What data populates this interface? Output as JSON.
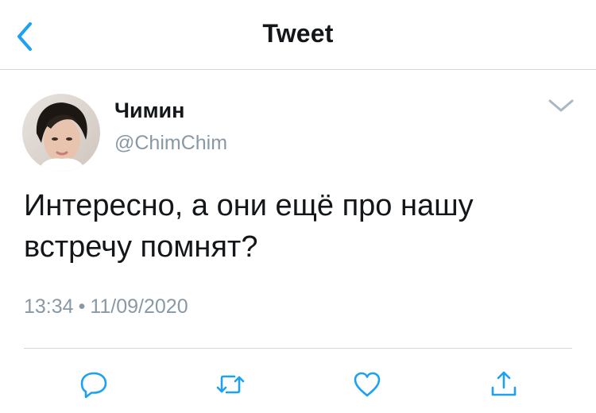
{
  "header": {
    "title": "Tweet",
    "back_icon": "chevron-left-icon"
  },
  "tweet": {
    "author": {
      "display_name": "Чимин",
      "handle": "@ChimChim",
      "avatar": "profile-photo"
    },
    "text": "Интересно, а они ещё про нашу встречу помнят?",
    "time": "13:34",
    "separator": "•",
    "date": "11/09/2020",
    "menu_icon": "chevron-down-icon"
  },
  "actions": [
    {
      "name": "reply",
      "icon": "reply-icon"
    },
    {
      "name": "retweet",
      "icon": "retweet-icon"
    },
    {
      "name": "like",
      "icon": "heart-icon"
    },
    {
      "name": "share",
      "icon": "share-icon"
    }
  ],
  "colors": {
    "accent": "#1da1f2",
    "text": "#14171a",
    "secondary": "#8899a6",
    "divider": "#cfd6dc"
  }
}
